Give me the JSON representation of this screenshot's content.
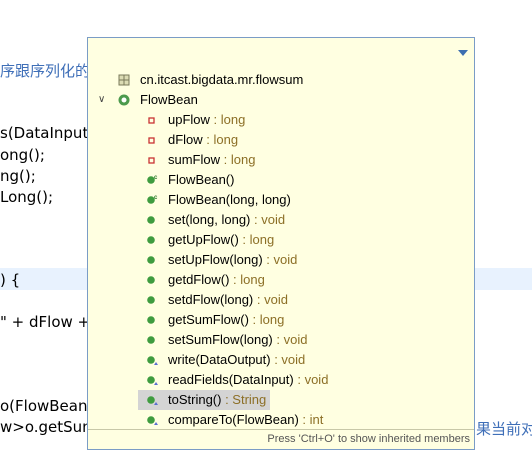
{
  "editor": {
    "lines": [
      {
        "text": "序跟序列化的",
        "blue": true
      },
      {
        "text": "s(DataInput",
        "blue": false
      },
      {
        "text": "ong();",
        "blue": false
      },
      {
        "text": "ng();",
        "blue": false
      },
      {
        "text": "Long();",
        "blue": false
      },
      {
        "text": ") {",
        "blue": false
      },
      {
        "text": "\" + dFlow +",
        "blue": false
      },
      {
        "text": "o(FlowBean o",
        "blue": false
      },
      {
        "text": "w>o.getSum",
        "blue": false
      }
    ],
    "right_text": "果当前对"
  },
  "popup": {
    "filter_value": "",
    "status": "Press 'Ctrl+O' to show inherited members",
    "items": [
      {
        "name": "cn.itcast.bigdata.mr.flowsum",
        "type": "",
        "icon": "import-container-icon",
        "indent": 0
      },
      {
        "name": "FlowBean",
        "type": "",
        "icon": "class-icon",
        "indent": 0,
        "expanded": true
      },
      {
        "name": "upFlow",
        "type": " : long",
        "icon": "private-field-icon",
        "indent": 1
      },
      {
        "name": "dFlow",
        "type": " : long",
        "icon": "private-field-icon",
        "indent": 1
      },
      {
        "name": "sumFlow",
        "type": " : long",
        "icon": "private-field-icon",
        "indent": 1
      },
      {
        "name": "FlowBean()",
        "type": "",
        "icon": "constructor-icon",
        "indent": 1
      },
      {
        "name": "FlowBean(long, long)",
        "type": "",
        "icon": "constructor-icon",
        "indent": 1
      },
      {
        "name": "set(long, long)",
        "type": " : void",
        "icon": "public-method-icon",
        "indent": 1
      },
      {
        "name": "getUpFlow()",
        "type": " : long",
        "icon": "public-method-icon",
        "indent": 1
      },
      {
        "name": "setUpFlow(long)",
        "type": " : void",
        "icon": "public-method-icon",
        "indent": 1
      },
      {
        "name": "getdFlow()",
        "type": " : long",
        "icon": "public-method-icon",
        "indent": 1
      },
      {
        "name": "setdFlow(long)",
        "type": " : void",
        "icon": "public-method-icon",
        "indent": 1
      },
      {
        "name": "getSumFlow()",
        "type": " : long",
        "icon": "public-method-icon",
        "indent": 1
      },
      {
        "name": "setSumFlow(long)",
        "type": " : void",
        "icon": "public-method-icon",
        "indent": 1
      },
      {
        "name": "write(DataOutput)",
        "type": " : void",
        "icon": "override-method-icon",
        "indent": 1
      },
      {
        "name": "readFields(DataInput)",
        "type": " : void",
        "icon": "override-method-icon",
        "indent": 1
      },
      {
        "name": "toString()",
        "type": " : String",
        "icon": "override-method-icon",
        "indent": 1,
        "selected": true
      },
      {
        "name": "compareTo(FlowBean)",
        "type": " : int",
        "icon": "override-method-icon",
        "indent": 1
      }
    ]
  },
  "colors": {
    "popup_bg": "#ffffe1",
    "type_text": "#8c6f26",
    "method_green": "#3f9c3f",
    "field_red": "#c83232"
  }
}
